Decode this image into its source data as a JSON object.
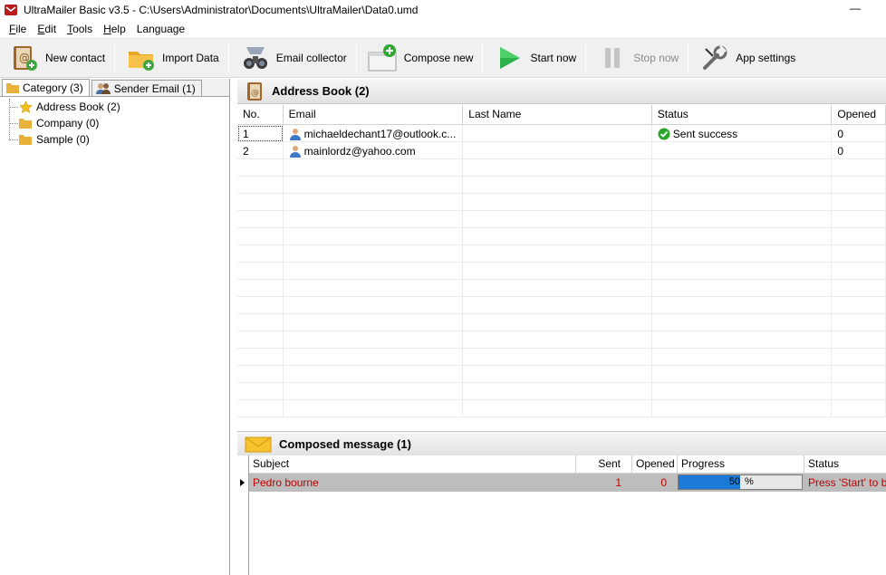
{
  "window": {
    "title": "UltraMailer Basic v3.5 - C:\\Users\\Administrator\\Documents\\UltraMailer\\Data0.umd",
    "minimize_glyph": "—"
  },
  "menu": [
    {
      "label": "File",
      "accel": "F",
      "rest": "ile"
    },
    {
      "label": "Edit",
      "accel": "E",
      "rest": "dit"
    },
    {
      "label": "Tools",
      "accel": "T",
      "rest": "ools"
    },
    {
      "label": "Help",
      "accel": "H",
      "rest": "elp"
    },
    {
      "label": "Language",
      "accel": "",
      "rest": "Language"
    }
  ],
  "toolbar": {
    "new_contact": "New contact",
    "import_data": "Import Data",
    "email_collector": "Email collector",
    "compose_new": "Compose new",
    "start_now": "Start now",
    "stop_now": "Stop now",
    "app_settings": "App settings"
  },
  "left_tabs": {
    "category": "Category (3)",
    "sender_email": "Sender Email (1)"
  },
  "tree": [
    {
      "label": "Address Book (2)",
      "icon": "star-icon"
    },
    {
      "label": "Company (0)",
      "icon": "folder-icon"
    },
    {
      "label": "Sample (0)",
      "icon": "folder-icon"
    }
  ],
  "address_book": {
    "title": "Address Book (2)",
    "columns": {
      "no": "No.",
      "email": "Email",
      "last_name": "Last Name",
      "status": "Status",
      "opened": "Opened"
    },
    "rows": [
      {
        "no": "1",
        "email": "michaeldechant17@outlook.c...",
        "last_name": "",
        "status": "Sent success",
        "opened": "0"
      },
      {
        "no": "2",
        "email": "mainlordz@yahoo.com",
        "last_name": "",
        "status": "",
        "opened": "0"
      }
    ]
  },
  "composed": {
    "title": "Composed message (1)",
    "columns": {
      "subject": "Subject",
      "sent": "Sent",
      "opened": "Opened",
      "progress": "Progress",
      "status": "Status"
    },
    "row": {
      "subject": "Pedro bourne",
      "sent": "1",
      "opened": "0",
      "progress_value": "50",
      "progress_suffix": "%",
      "progress_fraction": 0.5,
      "status": "Press 'Start' to b"
    }
  },
  "colors": {
    "accent_blue": "#1c7ad6",
    "row_text_red": "#c00000",
    "success_green": "#2aa52a"
  }
}
